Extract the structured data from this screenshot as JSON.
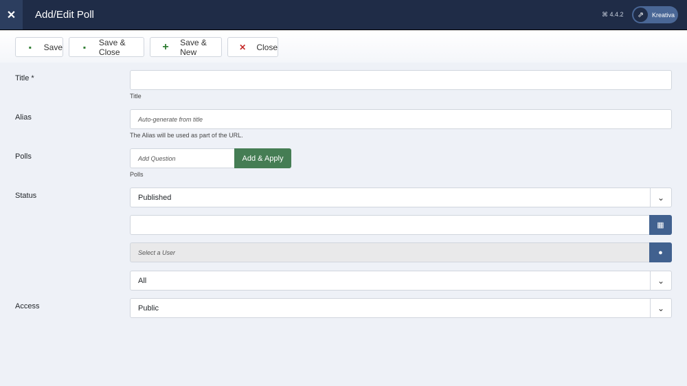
{
  "header": {
    "title": "Add/Edit Poll",
    "version": "4.4.2",
    "user": "Kreativa"
  },
  "toolbar": {
    "save": "Save",
    "save_close": "Save & Close",
    "save_new": "Save & New",
    "close": "Close"
  },
  "form": {
    "title_label": "Title *",
    "title_help": "Title",
    "title_value": "",
    "alias_label": "Alias",
    "alias_placeholder": "Auto-generate from title",
    "alias_help": "The Alias will be used as part of the URL.",
    "polls_label": "Polls",
    "polls_placeholder": "Add Question",
    "polls_button": "Add & Apply",
    "polls_help": "Polls",
    "status_label": "Status",
    "status_value": "Published",
    "date_value": "",
    "user_placeholder": "Select a User",
    "language_value": "All",
    "access_label": "Access",
    "access_value": "Public"
  }
}
